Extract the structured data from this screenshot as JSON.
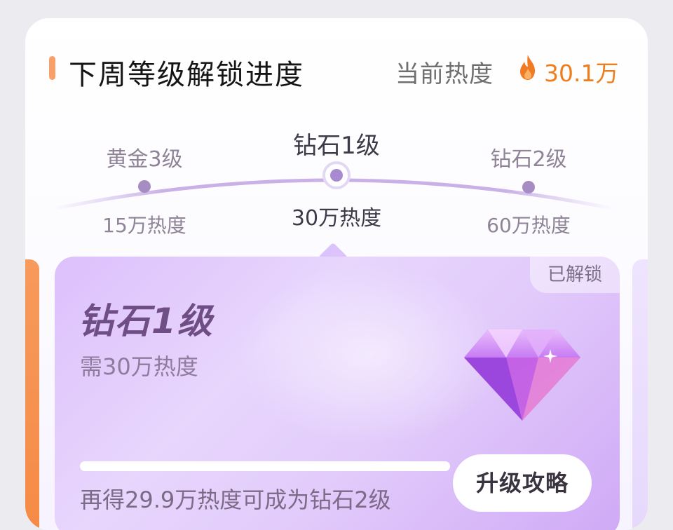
{
  "header": {
    "title": "下周等级解锁进度",
    "heat_label": "当前热度",
    "heat_value": "30.1万",
    "fire_icon": "fire-icon",
    "accent_color": "#f7a06a",
    "heat_color": "#ef7d1c"
  },
  "levels": [
    {
      "name": "黄金3级",
      "requirement": "15万热度",
      "active": false
    },
    {
      "name": "钻石1级",
      "requirement": "30万热度",
      "active": true
    },
    {
      "name": "钻石2级",
      "requirement": "60万热度",
      "active": false
    }
  ],
  "card": {
    "badge": "已解锁",
    "title": "钻石1级",
    "subtitle": "需30万热度",
    "progress": 1.0,
    "remaining_text": "再得29.9万热度可成为钻石2级",
    "button_label": "升级攻略",
    "icon": "diamond-icon",
    "theme_color": "#dcc0fb"
  }
}
